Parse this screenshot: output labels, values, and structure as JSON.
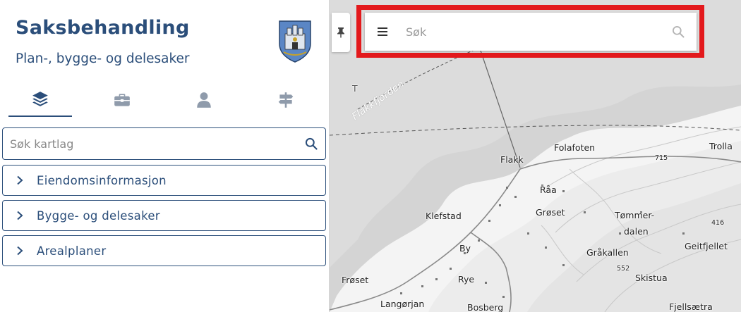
{
  "app": {
    "title": "Saksbehandling",
    "subtitle": "Plan-, bygge- og delesaker",
    "crest": "municipal-coat-of-arms"
  },
  "tabs": [
    {
      "name": "layers",
      "icon": "layers-icon",
      "active": true
    },
    {
      "name": "tools",
      "icon": "briefcase-icon",
      "active": false
    },
    {
      "name": "user",
      "icon": "user-icon",
      "active": false
    },
    {
      "name": "directions",
      "icon": "signpost-icon",
      "active": false
    }
  ],
  "layer_search": {
    "placeholder": "Søk kartlag"
  },
  "accordion": [
    {
      "label": "Eiendomsinformasjon"
    },
    {
      "label": "Bygge- og delesaker"
    },
    {
      "label": "Arealplaner"
    }
  ],
  "map_search": {
    "placeholder": "Søk"
  },
  "map_labels": {
    "water": "Flakkfjorden",
    "partial_top": "T",
    "places": [
      "Flakk",
      "Folafoten",
      "Trolla",
      "Råa",
      "Klefstad",
      "Grøset",
      "Tømmer-",
      "dalen",
      "By",
      "Gråkallen",
      "Geitfjellet",
      "Frøset",
      "Rye",
      "Skistua",
      "Langørjan",
      "Bosberg",
      "Fjellsætra"
    ],
    "elevations": [
      "715",
      "416",
      "552"
    ]
  },
  "colors": {
    "brand": "#2b4e7a",
    "highlight": "#e3191c",
    "sea": "#d9d9d9",
    "land": "#f4f4f4"
  }
}
